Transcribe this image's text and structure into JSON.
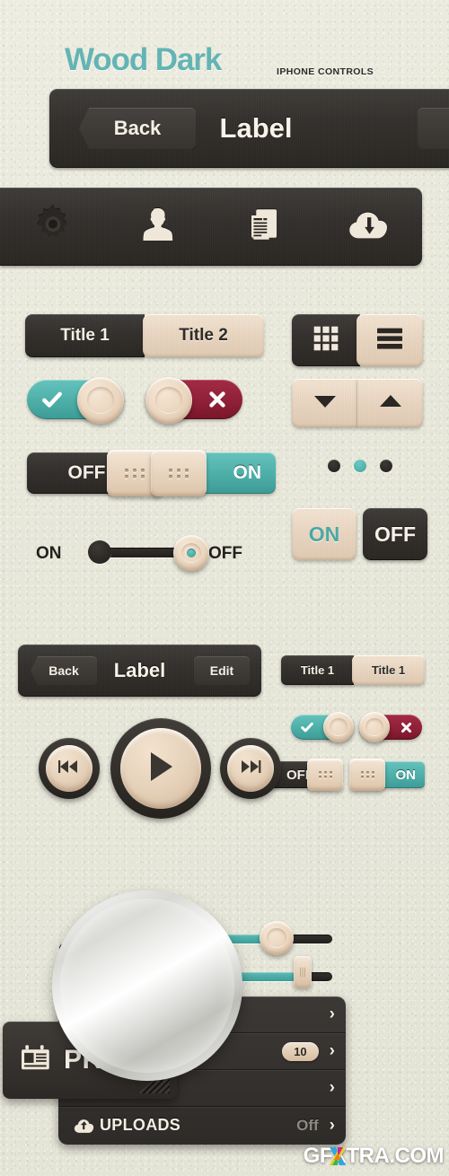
{
  "header": {
    "title": "Wood Dark",
    "subtitle": "IPHONE CONTROLS",
    "title_color": "#64b4b4",
    "subtitle_color": "#2b2b28"
  },
  "navbar_large": {
    "back_label": "Back",
    "title": "Label"
  },
  "toolbar": {
    "items": [
      {
        "icon": "gear-icon",
        "label": "Settings"
      },
      {
        "icon": "person-icon",
        "label": "Profile"
      },
      {
        "icon": "document-icon",
        "label": "Documents"
      },
      {
        "icon": "cloud-download-icon",
        "label": "Download"
      }
    ]
  },
  "segmented_large": {
    "options": [
      {
        "label": "Title 1",
        "selected": true
      },
      {
        "label": "Title 2",
        "selected": false
      }
    ]
  },
  "toggle_check": {
    "state": "on",
    "glyph": "check-icon",
    "color": "#4fb0aa"
  },
  "toggle_cross": {
    "state": "off",
    "glyph": "cross-icon",
    "color": "#8d1f36"
  },
  "view_segmented": {
    "options": [
      {
        "icon": "grid-view-icon",
        "selected": true
      },
      {
        "icon": "list-view-icon",
        "selected": false
      }
    ]
  },
  "stepper": {
    "options": [
      {
        "icon": "arrow-down-icon"
      },
      {
        "icon": "arrow-up-icon"
      }
    ]
  },
  "page_dots": {
    "count": 3,
    "active_index": 1,
    "active_color": "#4fb0aa"
  },
  "switch_off": {
    "label": "OFF",
    "state": "off"
  },
  "switch_on": {
    "label": "ON",
    "state": "on"
  },
  "line_slider": {
    "left_label": "ON",
    "right_label": "OFF",
    "position": "right"
  },
  "buttons": [
    {
      "label": "ON",
      "style": "cream",
      "text_color": "#4aa9a3"
    },
    {
      "label": "OFF",
      "style": "dark",
      "text_color": "#f6f2e7"
    }
  ],
  "navbar_small": {
    "back_label": "Back",
    "title": "Label",
    "edit_label": "Edit"
  },
  "segmented_small": {
    "options": [
      {
        "label": "Title 1",
        "selected": true
      },
      {
        "label": "Title 1",
        "selected": false
      }
    ]
  },
  "toggle_check_small": {
    "state": "on",
    "glyph": "check-icon"
  },
  "toggle_cross_small": {
    "state": "off",
    "glyph": "cross-icon"
  },
  "switch_off_small": {
    "label": "OFF",
    "state": "off"
  },
  "switch_on_small": {
    "label": "ON",
    "state": "on"
  },
  "media_player": {
    "previous": "previous-track-icon",
    "play": "play-icon",
    "next": "next-track-icon"
  },
  "sliders": [
    {
      "name": "slider-large",
      "value_percent": 52,
      "knob": "rect-grip"
    },
    {
      "name": "slider-round",
      "value_percent": 45,
      "knob": "round"
    },
    {
      "name": "slider-small",
      "value_percent": 75,
      "knob": "rect-grip"
    }
  ],
  "magnifier": {
    "shape": "lens-circle"
  },
  "profile_panel": {
    "icon": "contact-card-icon",
    "label": "PRO"
  },
  "list_menu": {
    "rows": [
      {
        "icon": "",
        "label": "",
        "value": "",
        "chevron": "›"
      },
      {
        "icon": "",
        "label": "",
        "value": "",
        "badge": "10",
        "chevron": "›"
      },
      {
        "icon": "",
        "label": "S",
        "value": "",
        "chevron": "›"
      },
      {
        "icon": "cloud-upload-icon",
        "label": "UPLOADS",
        "value": "Off",
        "chevron": "›"
      }
    ]
  },
  "watermark": {
    "text": "GFXTRA.COM"
  }
}
